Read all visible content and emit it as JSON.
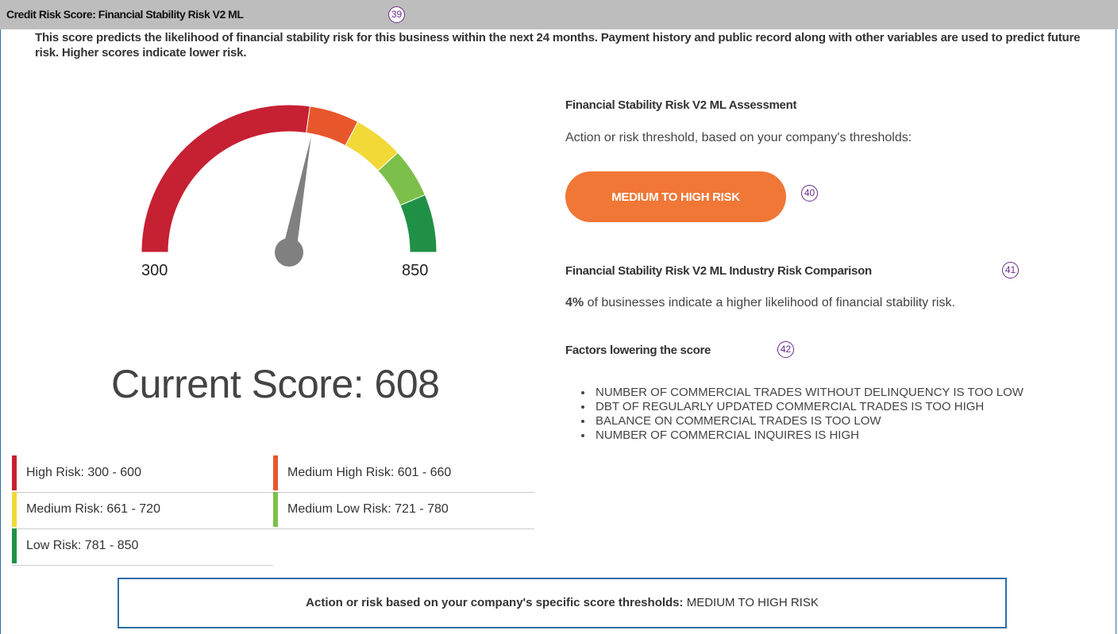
{
  "header": {
    "title": "Credit Risk Score: Financial Stability Risk V2 ML",
    "badge": "39"
  },
  "description": "This score predicts the likelihood of financial stability risk for this business within the next 24 months. Payment history and public record along with other variables are used to predict future risk. Higher scores indicate lower risk.",
  "gauge": {
    "min_label": "300",
    "max_label": "850",
    "min": 300,
    "max": 850,
    "value": 608,
    "segments": [
      {
        "name": "high",
        "from": 300,
        "to": 600,
        "color": "#c62033"
      },
      {
        "name": "medium-high",
        "from": 600,
        "to": 660,
        "color": "#e8572b"
      },
      {
        "name": "medium",
        "from": 660,
        "to": 720,
        "color": "#f2d938"
      },
      {
        "name": "medium-low",
        "from": 720,
        "to": 780,
        "color": "#7cc04b"
      },
      {
        "name": "low",
        "from": 780,
        "to": 850,
        "color": "#219047"
      }
    ],
    "needle_color": "#808080"
  },
  "current_score": "Current Score: 608",
  "legend": [
    {
      "label": "High Risk: 300 - 600",
      "color": "#c62033"
    },
    {
      "label": "Medium High Risk: 601 - 660",
      "color": "#e8572b"
    },
    {
      "label": "Medium Risk: 661 - 720",
      "color": "#f2d938"
    },
    {
      "label": "Medium Low Risk: 721 - 780",
      "color": "#7cc04b"
    },
    {
      "label": "Low Risk: 781 - 850",
      "color": "#219047"
    }
  ],
  "assessment": {
    "title": "Financial Stability Risk V2 ML Assessment",
    "subtitle": "Action or risk threshold, based on your company's thresholds:",
    "button_label": "MEDIUM TO HIGH RISK",
    "badge": "40",
    "button_color": "#f07736"
  },
  "comparison": {
    "title": "Financial Stability Risk V2 ML Industry Risk Comparison",
    "badge": "41",
    "percent": "4%",
    "text": " of businesses indicate a higher likelihood of financial stability risk."
  },
  "factors": {
    "title": "Factors lowering the score",
    "badge": "42",
    "items": [
      "NUMBER OF COMMERCIAL TRADES WITHOUT DELINQUENCY IS TOO LOW",
      "DBT OF REGULARLY UPDATED COMMERCIAL TRADES IS TOO HIGH",
      "BALANCE ON COMMERCIAL TRADES IS TOO LOW",
      "NUMBER OF COMMERCIAL INQUIRES IS HIGH"
    ]
  },
  "bottom": {
    "label": "Action or risk based on your company's specific score thresholds:",
    "value": "MEDIUM TO HIGH RISK"
  },
  "colors": {
    "header_bg": "#bdbdbd",
    "frame_border": "#2c6ea8",
    "badge": "#6b2a8a"
  }
}
